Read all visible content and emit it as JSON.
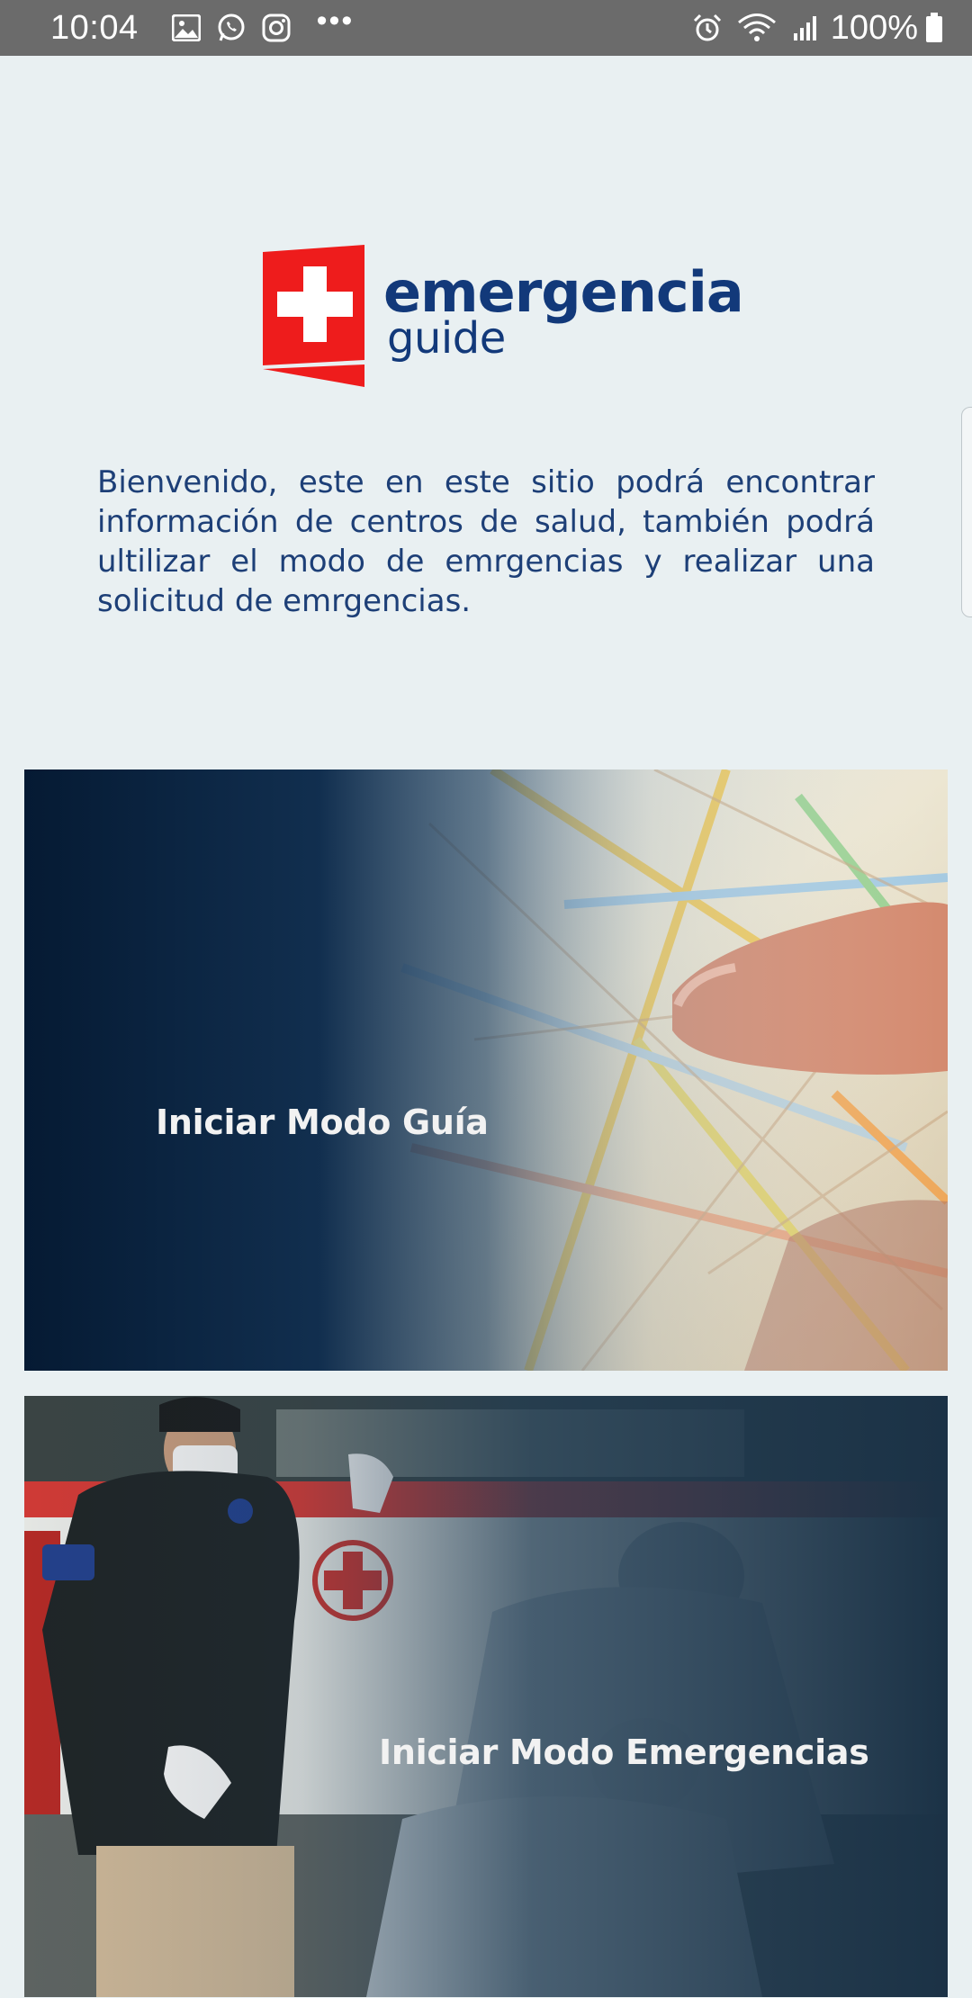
{
  "status_bar": {
    "time": "10:04",
    "left_icons": [
      "gallery-icon",
      "whatsapp-icon",
      "instagram-icon",
      "more-dots-icon"
    ],
    "right_icons": [
      "alarm-icon",
      "wifi-icon",
      "signal-icon",
      "battery-icon"
    ],
    "battery": "100%",
    "dots": "•••"
  },
  "logo": {
    "word": "emergencia",
    "sub": "guide",
    "brand_red": "#ee1c1c",
    "brand_blue": "#12397a"
  },
  "intro": {
    "text": "Bienvenido, este en este sitio podrá encontrar información de centros de salud, también podrá ultilizar el modo de emrgencias y realizar una solicitud de emrgencias."
  },
  "cards": [
    {
      "label": "Iniciar Modo Guía"
    },
    {
      "label": "Iniciar Modo Emergencias"
    }
  ]
}
